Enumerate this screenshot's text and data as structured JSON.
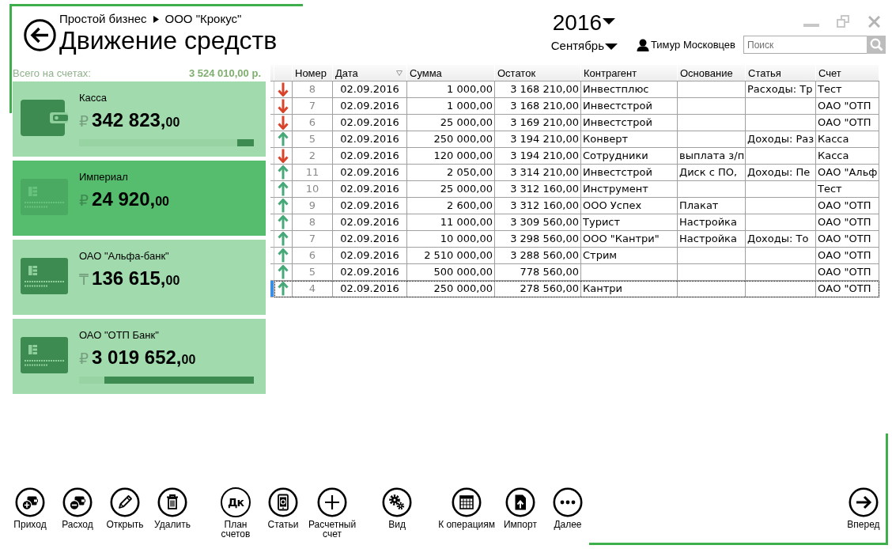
{
  "header": {
    "breadcrumb": [
      "Простой бизнес",
      "ООО \"Крокус\""
    ],
    "title": "Движение средств"
  },
  "period": {
    "year": "2016",
    "month": "Сентябрь"
  },
  "user": {
    "name": "Тимур Московцев"
  },
  "search": {
    "placeholder": "Поиск"
  },
  "accounts": {
    "total_label": "Всего на счетах:",
    "total": "3 524 010,00 р.",
    "items": [
      {
        "kind": "cash",
        "name": "Касса",
        "currency": "₽",
        "amount": "342 823,",
        "fraction": "00",
        "selected": false,
        "level": 0.097
      },
      {
        "kind": "card",
        "name": "Империал",
        "currency": "₽",
        "amount": "24 920,",
        "fraction": "00",
        "selected": true
      },
      {
        "kind": "card",
        "name": "ОАО \"Альфа-банк\"",
        "currency": "₸",
        "amount": "136 615,",
        "fraction": "00",
        "selected": false
      },
      {
        "kind": "card",
        "name": "ОАО \"ОТП Банк\"",
        "currency": "₽",
        "amount": "3 019 652,",
        "fraction": "00",
        "selected": false,
        "level": 0.857
      }
    ]
  },
  "table": {
    "columns": [
      {
        "label": "Номер",
        "filter": false
      },
      {
        "label": "Дата",
        "filter": true
      },
      {
        "label": "Сумма",
        "filter": false
      },
      {
        "label": "Остаток",
        "filter": false
      },
      {
        "label": "Контрагент",
        "filter": false
      },
      {
        "label": "Основание",
        "filter": false
      },
      {
        "label": "Статья",
        "filter": false
      },
      {
        "label": "Счет",
        "filter": false
      }
    ],
    "rows": [
      {
        "kind": "expense",
        "number": "8",
        "date": "02.09.2016",
        "amount": "1 000,00",
        "balance": "3 168 210,00",
        "counterparty": "Инвестплюс",
        "article": "Расходы: Тр",
        "account": "Тест",
        "selected": false
      },
      {
        "kind": "expense",
        "number": "7",
        "date": "02.09.2016",
        "amount": "1 000,00",
        "balance": "3 168 210,00",
        "counterparty": "Инвестстрой",
        "account": "ОАО \"ОТП",
        "selected": false
      },
      {
        "kind": "expense",
        "number": "6",
        "date": "02.09.2016",
        "amount": "25 000,00",
        "balance": "3 169 210,00",
        "counterparty": "Инвестстрой",
        "account": "ОАО \"ОТП",
        "selected": false
      },
      {
        "kind": "income",
        "number": "5",
        "date": "02.09.2016",
        "amount": "250 000,00",
        "balance": "3 194 210,00",
        "counterparty": "Конверт",
        "article": "Доходы: Раз",
        "account": "Касса",
        "selected": false
      },
      {
        "kind": "expense",
        "number": "2",
        "date": "02.09.2016",
        "amount": "120 000,00",
        "balance": "3 194 210,00",
        "counterparty": "Сотрудники",
        "basis": "выплата з/п",
        "account": "Касса",
        "selected": false
      },
      {
        "kind": "income",
        "number": "11",
        "date": "02.09.2016",
        "amount": "2 050,00",
        "balance": "3 314 210,00",
        "counterparty": "Инвестстрой",
        "basis": "Диск с ПО,",
        "article": "Доходы: Пе",
        "account": "ОАО \"Альф",
        "selected": false
      },
      {
        "kind": "income",
        "number": "10",
        "date": "02.09.2016",
        "amount": "25 000,00",
        "balance": "3 312 160,00",
        "counterparty": "Инструмент",
        "account": "Тест",
        "selected": false
      },
      {
        "kind": "income",
        "number": "9",
        "date": "02.09.2016",
        "amount": "2 600,00",
        "balance": "3 312 160,00",
        "counterparty": "ООО Успех",
        "basis": "Плакат",
        "account": "ОАО \"ОТП",
        "selected": false
      },
      {
        "kind": "income",
        "number": "8",
        "date": "02.09.2016",
        "amount": "11 000,00",
        "balance": "3 309 560,00",
        "counterparty": "Турист",
        "basis": "Настройка",
        "account": "ОАО \"ОТП",
        "selected": false
      },
      {
        "kind": "income",
        "number": "7",
        "date": "02.09.2016",
        "amount": "10 000,00",
        "balance": "3 298 560,00",
        "counterparty": "ООО \"Кантри\"",
        "basis": "Настройка",
        "article": "Доходы: То",
        "account": "ОАО \"ОТП",
        "selected": false
      },
      {
        "kind": "income",
        "number": "6",
        "date": "02.09.2016",
        "amount": "2 510 000,00",
        "balance": "3 288 560,00",
        "counterparty": "Стрим",
        "account": "ОАО \"ОТП",
        "selected": false
      },
      {
        "kind": "income",
        "number": "5",
        "date": "02.09.2016",
        "amount": "500 000,00",
        "balance": "778 560,00",
        "account": "ОАО \"ОТП",
        "selected": false
      },
      {
        "kind": "income",
        "number": "4",
        "date": "02.09.2016",
        "amount": "250 000,00",
        "balance": "278 560,00",
        "counterparty": "Кантри",
        "account": "ОАО \"ОТП",
        "selected": true
      }
    ]
  },
  "toolbar": {
    "groups": [
      {
        "buttons": [
          {
            "kind": "income",
            "label": "Приход"
          },
          {
            "kind": "expense",
            "label": "Расход"
          },
          {
            "kind": "edit",
            "label": "Открыть"
          },
          {
            "kind": "delete",
            "label": "Удалить"
          }
        ]
      },
      {
        "buttons": [
          {
            "kind": "accounts",
            "label": "План\nсчетов",
            "glyph": "Дк"
          },
          {
            "kind": "articles",
            "label": "Статьи"
          },
          {
            "kind": "add",
            "label": "Расчетный\nсчет"
          }
        ]
      },
      {
        "buttons": [
          {
            "kind": "view",
            "label": "Вид"
          }
        ]
      },
      {
        "buttons": [
          {
            "kind": "operations",
            "label": "К операциям"
          },
          {
            "kind": "import",
            "label": "Импорт"
          },
          {
            "kind": "more",
            "label": "Далее"
          }
        ]
      }
    ],
    "forward": {
      "kind": "forward",
      "label": "Вперед"
    }
  }
}
